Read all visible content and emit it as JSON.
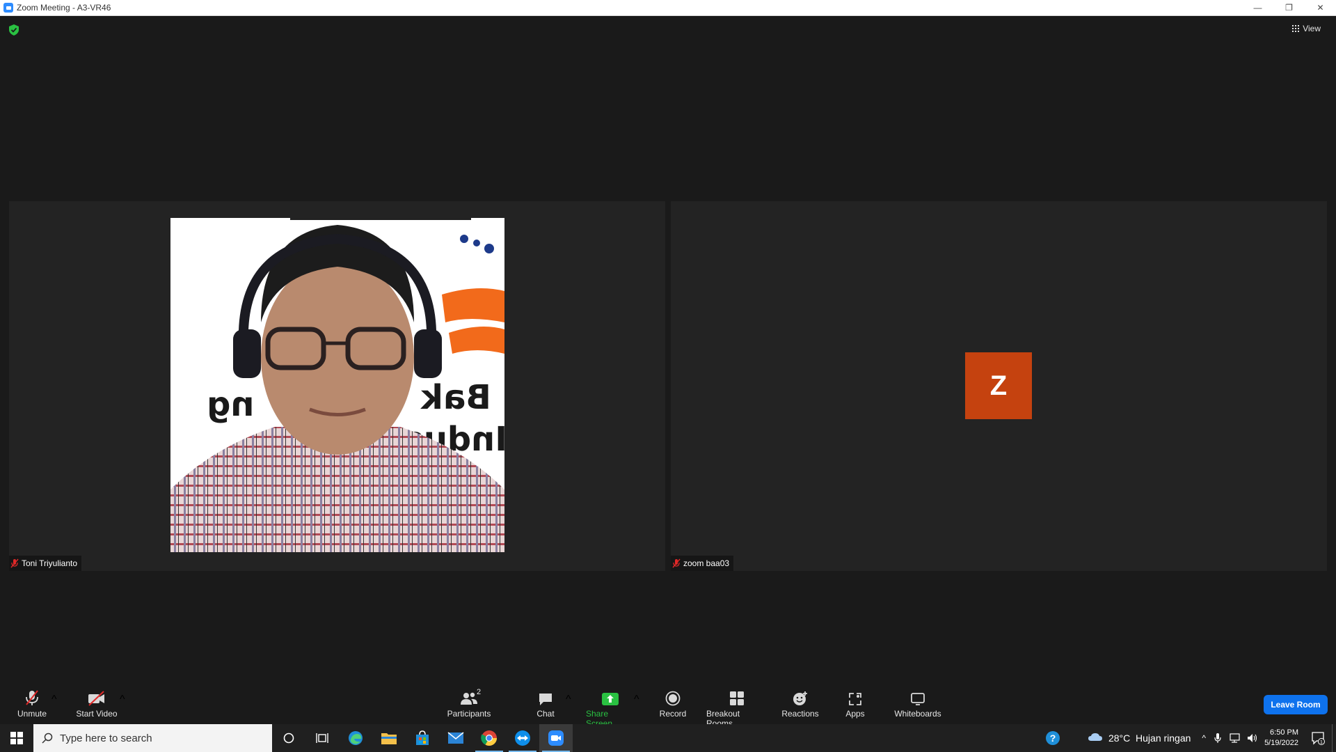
{
  "window": {
    "title": "Zoom Meeting - A3-VR46",
    "minimize_glyph": "—",
    "restore_glyph": "❐",
    "close_glyph": "✕"
  },
  "topbar": {
    "security_icon": "shield-check-icon",
    "view_label": "View"
  },
  "participants": [
    {
      "name": "Toni Triyulianto",
      "muted": true,
      "video_on": true,
      "background_text": [
        "Bak",
        "ng",
        "Indus"
      ]
    },
    {
      "name": "zoom baa03",
      "muted": true,
      "video_on": false,
      "avatar_initial": "Z",
      "avatar_color": "#c5420f"
    }
  ],
  "controls": {
    "unmute_label": "Unmute",
    "start_video_label": "Start Video",
    "participants_label": "Participants",
    "participants_count": "2",
    "chat_label": "Chat",
    "share_screen_label": "Share Screen",
    "record_label": "Record",
    "breakout_rooms_label": "Breakout Rooms",
    "reactions_label": "Reactions",
    "apps_label": "Apps",
    "whiteboards_label": "Whiteboards",
    "leave_label": "Leave Room",
    "caret": "^",
    "share_color": "#2ac142",
    "leave_color": "#0e72ed"
  },
  "taskbar": {
    "search_placeholder": "Type here to search",
    "weather": "28°C  Hujan ringan",
    "time": "6:50 PM",
    "date": "5/19/2022",
    "notification_count": "1",
    "help_glyph": "?",
    "tray_chevron": "^"
  }
}
